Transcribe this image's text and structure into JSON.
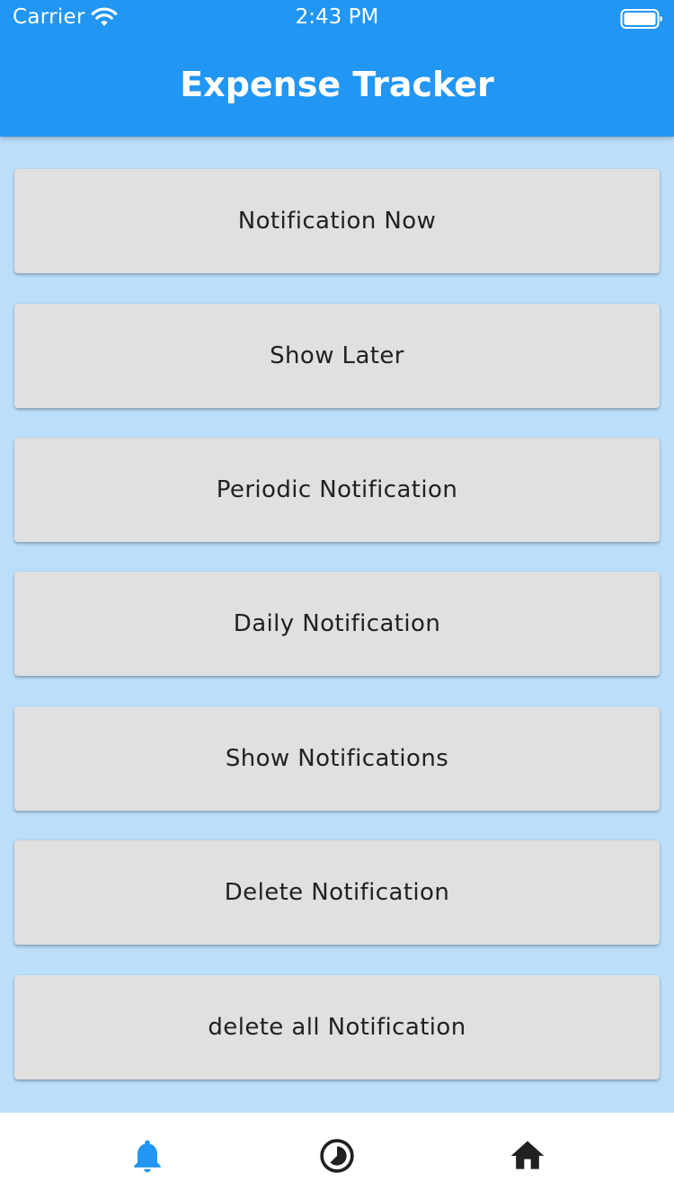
{
  "status_bar": {
    "carrier": "Carrier",
    "time": "2:43 PM"
  },
  "app_bar": {
    "title": "Expense Tracker"
  },
  "buttons": [
    {
      "label": "Notification Now"
    },
    {
      "label": "Show Later"
    },
    {
      "label": "Periodic Notification"
    },
    {
      "label": "Daily Notification"
    },
    {
      "label": "Show Notifications"
    },
    {
      "label": "Delete Notification"
    },
    {
      "label": "delete all Notification"
    }
  ],
  "bottom_nav": {
    "items": [
      {
        "icon": "bell-icon",
        "active": true
      },
      {
        "icon": "clock-icon",
        "active": false
      },
      {
        "icon": "home-icon",
        "active": false
      }
    ]
  },
  "colors": {
    "primary": "#2196F3",
    "background": "#BBDEFB",
    "button": "#E0E0E0",
    "button_text": "#212121",
    "nav_active": "#2196F3",
    "nav_inactive": "#212121"
  }
}
